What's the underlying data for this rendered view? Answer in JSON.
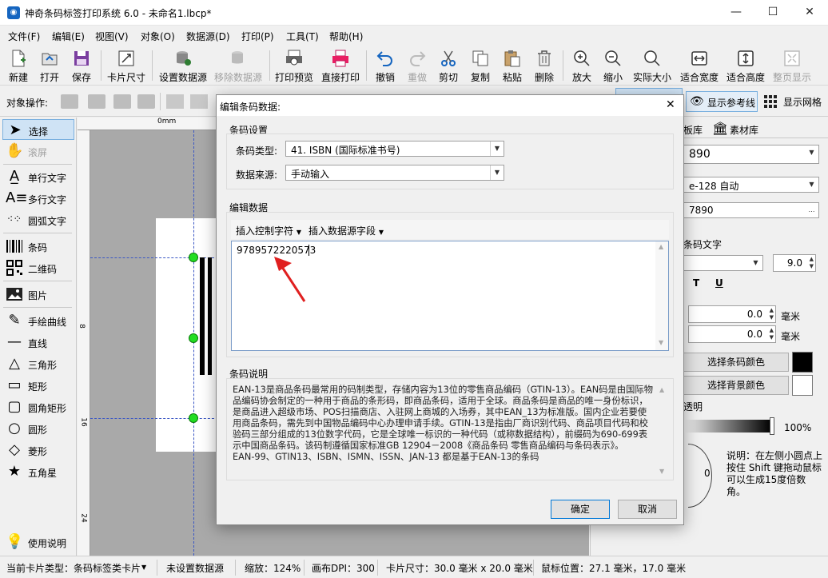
{
  "window": {
    "title": "神奇条码标签打印系统 6.0 - 未命名1.lbcp*",
    "minimize": "—",
    "maximize": "☐",
    "close": "✕",
    "app_icon": "app-logo-icon"
  },
  "menu": [
    "文件(F)",
    "编辑(E)",
    "视图(V)",
    "对象(O)",
    "数据源(D)",
    "打印(P)",
    "工具(T)",
    "帮助(H)"
  ],
  "toolbar": [
    {
      "label": "新建",
      "icon": "new-file-icon",
      "enabled": true
    },
    {
      "label": "打开",
      "icon": "open-folder-icon",
      "enabled": true
    },
    {
      "label": "保存",
      "icon": "save-icon",
      "enabled": true
    },
    {
      "label": "卡片尺寸",
      "icon": "card-size-icon",
      "enabled": true
    },
    {
      "label": "设置数据源",
      "icon": "database-icon",
      "enabled": true
    },
    {
      "label": "移除数据源",
      "icon": "database-remove-icon",
      "enabled": false
    },
    {
      "label": "打印预览",
      "icon": "print-preview-icon",
      "enabled": true
    },
    {
      "label": "直接打印",
      "icon": "printer-icon",
      "enabled": true
    },
    {
      "label": "撤销",
      "icon": "undo-icon",
      "enabled": true
    },
    {
      "label": "重做",
      "icon": "redo-icon",
      "enabled": false
    },
    {
      "label": "剪切",
      "icon": "scissors-icon",
      "enabled": true
    },
    {
      "label": "复制",
      "icon": "copy-icon",
      "enabled": true
    },
    {
      "label": "粘贴",
      "icon": "paste-icon",
      "enabled": true
    },
    {
      "label": "删除",
      "icon": "trash-icon",
      "enabled": true
    },
    {
      "label": "放大",
      "icon": "zoom-in-icon",
      "enabled": true
    },
    {
      "label": "缩小",
      "icon": "zoom-out-icon",
      "enabled": true
    },
    {
      "label": "实际大小",
      "icon": "actual-size-icon",
      "enabled": true
    },
    {
      "label": "适合宽度",
      "icon": "fit-width-icon",
      "enabled": true
    },
    {
      "label": "适合高度",
      "icon": "fit-height-icon",
      "enabled": true
    },
    {
      "label": "整页显示",
      "icon": "fit-page-icon",
      "enabled": false
    }
  ],
  "objbar": {
    "label": "对象操作:",
    "show_guides": "显示参考线",
    "show_grid": "显示网格"
  },
  "tools": [
    {
      "label": "选择",
      "icon": "pointer-icon",
      "selected": true
    },
    {
      "label": "滚屏",
      "icon": "hand-icon",
      "enabled": false
    },
    {
      "label": "单行文字",
      "icon": "single-line-text-icon"
    },
    {
      "label": "多行文字",
      "icon": "multi-line-text-icon"
    },
    {
      "label": "圆弧文字",
      "icon": "arc-text-icon"
    },
    {
      "label": "条码",
      "icon": "barcode-icon"
    },
    {
      "label": "二维码",
      "icon": "qrcode-icon"
    },
    {
      "label": "图片",
      "icon": "image-icon"
    },
    {
      "label": "手绘曲线",
      "icon": "pen-icon"
    },
    {
      "label": "直线",
      "icon": "line-icon"
    },
    {
      "label": "三角形",
      "icon": "triangle-icon"
    },
    {
      "label": "矩形",
      "icon": "rectangle-icon"
    },
    {
      "label": "圆角矩形",
      "icon": "rounded-rectangle-icon"
    },
    {
      "label": "圆形",
      "icon": "circle-icon"
    },
    {
      "label": "菱形",
      "icon": "diamond-icon"
    },
    {
      "label": "五角星",
      "icon": "star-icon"
    },
    {
      "label": "使用说明",
      "icon": "lightbulb-icon"
    }
  ],
  "ruler": {
    "h_label": "0mm",
    "v_labels": [
      "8",
      "16",
      "24"
    ]
  },
  "rightpanel": {
    "tabs": [
      "板库",
      "素材库"
    ],
    "barcode_value": "890",
    "encoding": "e-128 自动",
    "data_value": "7890",
    "text_label": "条码文字",
    "font_size": "9.0",
    "bold_btn": "T",
    "underline_btn": "U",
    "offset1": "0.0",
    "offset2": "0.0",
    "unit": "毫米",
    "bar_color_btn": "选择条码颜色",
    "bg_color_btn": "选择背景颜色",
    "bar_color": "#000000",
    "bg_color": "#ffffff",
    "transparency_label": "透明",
    "transparency": "100%",
    "rotation": "0",
    "rotate_hint": "说明：在左侧小圆点上按住 Shift 键拖动鼠标可以生成15度倍数角。"
  },
  "status": {
    "card_type": "当前卡片类型：条码标签类卡片",
    "datasource": "未设置数据源",
    "zoom": "缩放：124%",
    "dpi": "画布DPI：300",
    "card_size": "卡片尺寸：30.0 毫米 x 20.0 毫米",
    "mouse_pos": "鼠标位置：27.1 毫米，17.0 毫米"
  },
  "dialog": {
    "title": "编辑条码数据:",
    "close": "✕",
    "settings_group": "条码设置",
    "type_label": "条码类型:",
    "type_value": "41. ISBN (国际标准书号)",
    "source_label": "数据来源:",
    "source_value": "手动输入",
    "edit_group": "编辑数据",
    "insert_ctrl": "插入控制字符",
    "insert_field": "插入数据源字段",
    "data": "9789572220573",
    "desc_group": "条码说明",
    "description": "EAN-13是商品条码最常用的码制类型，存储内容为13位的零售商品编码（GTIN-13）。EAN码是由国际物品编码协会制定的一种用于商品的条形码，即商品条码，适用于全球。商品条码是商品的唯一身份标识，是商品进入超级市场、POS扫描商店、入驻网上商城的入场券，其中EAN_13为标准版。国内企业若要使用商品条码，需先到中国物品编码中心办理申请手续。GTIN-13是指由厂商识别代码、商品项目代码和校验码三部分组成的13位数字代码，它是全球唯一标识的一种代码（或称数据结构），前缀码为690-699表示中国商品条码。该码制遵循国家标准GB 12904－2008《商品条码 零售商品编码与条码表示》。",
    "description2": "EAN-99、GTIN13、ISBN、ISMN、ISSN、JAN-13 都是基于EAN-13的条码",
    "ok": "确定",
    "cancel": "取消"
  }
}
